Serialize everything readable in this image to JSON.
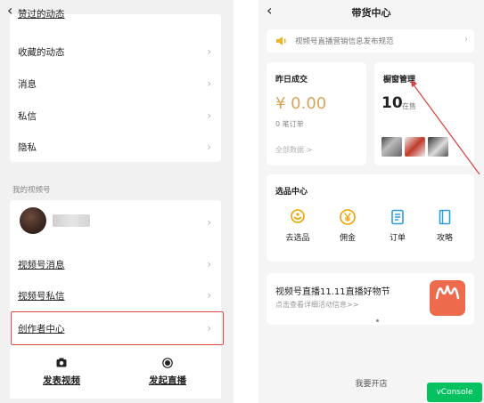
{
  "left": {
    "back_glyph": "‹",
    "cut_label": "赞过的动态",
    "menu": [
      {
        "label": "收藏的动态"
      },
      {
        "label": "消息"
      },
      {
        "label": "私信"
      },
      {
        "label": "隐私"
      }
    ],
    "section_title": "我的视频号",
    "channel_links": [
      {
        "label": "视频号消息"
      },
      {
        "label": "视频号私信"
      },
      {
        "label": "创作者中心"
      }
    ],
    "bottom": {
      "publish_label": "发表视频",
      "live_label": "发起直播"
    },
    "highlight_color": "#e24a4a"
  },
  "right": {
    "back_glyph": "‹",
    "title": "带货中心",
    "notice": "视频号直播营销信息发布规范",
    "yesterday": {
      "title": "昨日成交",
      "amount": "¥ 0.00",
      "orders": "0 笔订单",
      "link": "全部数据 >"
    },
    "window": {
      "title": "橱窗管理",
      "count": "10",
      "unit": "在售"
    },
    "selection": {
      "title": "选品中心",
      "items": [
        {
          "label": "去选品",
          "icon": "hand-coin-icon"
        },
        {
          "label": "佣金",
          "icon": "yuan-icon"
        },
        {
          "label": "订单",
          "icon": "order-list-icon"
        },
        {
          "label": "攻略",
          "icon": "book-icon"
        }
      ]
    },
    "promo": {
      "title": "视频号直播11.11直播好物节",
      "subtitle": "点击查看详细活动信息>>"
    },
    "open_shop": "我要开店",
    "vconsole": "vConsole",
    "accent_color": "#d7a55a",
    "icon_color": "#f0a100"
  }
}
